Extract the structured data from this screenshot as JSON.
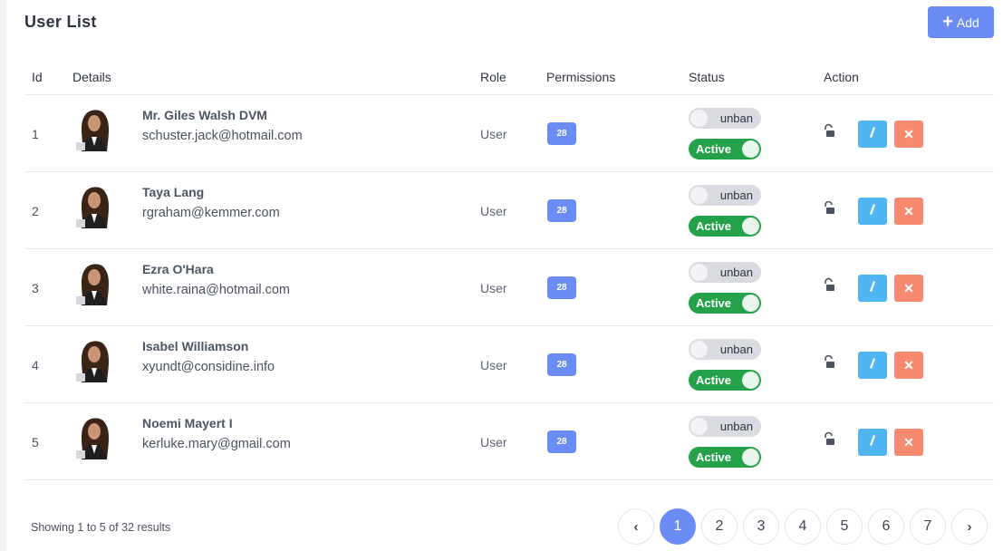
{
  "page": {
    "title": "User List",
    "add_label": "Add"
  },
  "table": {
    "headers": [
      "Id",
      "Details",
      "Role",
      "Permissions",
      "Status",
      "Action"
    ],
    "rows": [
      {
        "id": "1",
        "name": "Mr. Giles Walsh DVM",
        "email": "schuster.jack@hotmail.com",
        "role": "User",
        "permissions": "28",
        "ban_label": "unban",
        "active_label": "Active"
      },
      {
        "id": "2",
        "name": "Taya Lang",
        "email": "rgraham@kemmer.com",
        "role": "User",
        "permissions": "28",
        "ban_label": "unban",
        "active_label": "Active"
      },
      {
        "id": "3",
        "name": "Ezra O'Hara",
        "email": "white.raina@hotmail.com",
        "role": "User",
        "permissions": "28",
        "ban_label": "unban",
        "active_label": "Active"
      },
      {
        "id": "4",
        "name": "Isabel Williamson",
        "email": "xyundt@considine.info",
        "role": "User",
        "permissions": "28",
        "ban_label": "unban",
        "active_label": "Active"
      },
      {
        "id": "5",
        "name": "Noemi Mayert I",
        "email": "kerluke.mary@gmail.com",
        "role": "User",
        "permissions": "28",
        "ban_label": "unban",
        "active_label": "Active"
      }
    ]
  },
  "footer": {
    "summary": "Showing 1 to 5 of 32 results",
    "prev": "‹",
    "next": "›",
    "pages": [
      "1",
      "2",
      "3",
      "4",
      "5",
      "6",
      "7"
    ],
    "current_page": "1"
  },
  "colors": {
    "primary": "#6b8cf5",
    "active": "#25a14a",
    "edit": "#4fb5f3",
    "delete": "#f78a6e"
  },
  "icons": {
    "add": "plus-icon",
    "lock": "unlock-icon",
    "edit": "pencil-icon",
    "delete": "close-icon",
    "avatar": "user-photo"
  }
}
